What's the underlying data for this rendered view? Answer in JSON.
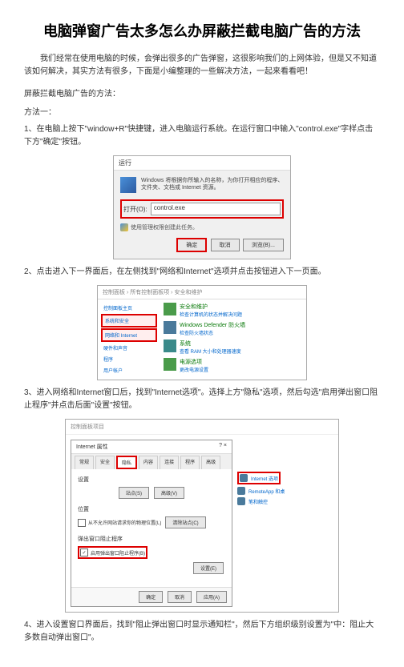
{
  "title": "电脑弹窗广告太多怎么办屏蔽拦截电脑广告的方法",
  "intro": "我们经常在使用电脑的时候，会弹出很多的广告弹窗，这很影响我们的上网体验，但是又不知道该如何解决，其实方法有很多，下面是小编整理的一些解决方法，一起来看看吧！",
  "section_label": "屏蔽拦截电脑广告的方法：",
  "method1_label": "方法一：",
  "step1": "1、在电脑上按下\"window+R\"快捷键，进入电脑运行系统。在运行窗口中输入\"control.exe\"字样点击下方\"确定\"按钮。",
  "step2": "2、点击进入下一界面后，在左侧找到\"网络和Internet\"选项并点击按钮进入下一页面。",
  "step3": "3、进入网络和Internet窗口后，找到\"Internet选项\"。选择上方\"隐私\"选项，然后勾选\"启用弹出窗口阻止程序\"并点击后面\"设置\"按钮。",
  "step4": "4、进入设置窗口界面后，找到\"阻止弹出窗口时显示通知栏\"，然后下方组织级别设置为\"中：阻止大多数自动弹出窗口\"。",
  "run": {
    "title": "运行",
    "desc": "Windows 将根据你所输入的名称，为你打开相应的程序、文件夹、文档或 Internet 资源。",
    "open_label": "打开(O):",
    "input_value": "control.exe",
    "shield_text": "使用管理权限创建此任务。",
    "ok": "确定",
    "cancel": "取消",
    "browse": "浏览(B)..."
  },
  "cp": {
    "breadcrumb": "控制面板 › 所有控制面板项 › 安全和维护",
    "sidebar": {
      "item0": "控制面板主页",
      "item1": "系统和安全",
      "item2": "网络和 Internet",
      "item3": "硬件和声音",
      "item4": "程序",
      "item5": "用户帐户"
    },
    "groups": {
      "g0": {
        "title": "安全和维护",
        "sub": "检查计算机的状态并解决问题"
      },
      "g1": {
        "title": "Windows Defender 防火墙",
        "sub": "检查防火墙状态"
      },
      "g2": {
        "title": "系统",
        "sub": "查看 RAM 大小和处理器速度"
      },
      "g3": {
        "title": "电源选项",
        "sub": "更改电源设置"
      }
    }
  },
  "io": {
    "breadcrumb": "控制面板项目",
    "dialog_title": "Internet 属性",
    "close": "?    ×",
    "tabs": {
      "t0": "常规",
      "t1": "安全",
      "t2": "隐私",
      "t3": "内容",
      "t4": "连接",
      "t5": "程序",
      "t6": "高级"
    },
    "fs_settings": "设置",
    "btn_site": "站点(S)",
    "btn_adv": "高级(V)",
    "fs_location": "位置",
    "chk_location": "从不允许网站请求你的物理位置(L)",
    "btn_clear": "清除站点(C)",
    "fs_popup": "弹出窗口阻止程序",
    "chk_popup": "启用弹出窗口阻止程序(B)",
    "btn_settings": "设置(E)",
    "btn_ok": "确定",
    "btn_cancel": "取消",
    "btn_apply": "应用(A)",
    "right": {
      "r0": "Internet 选项",
      "r1": "RemoteApp 和桌",
      "r2": "笔和触控"
    }
  }
}
